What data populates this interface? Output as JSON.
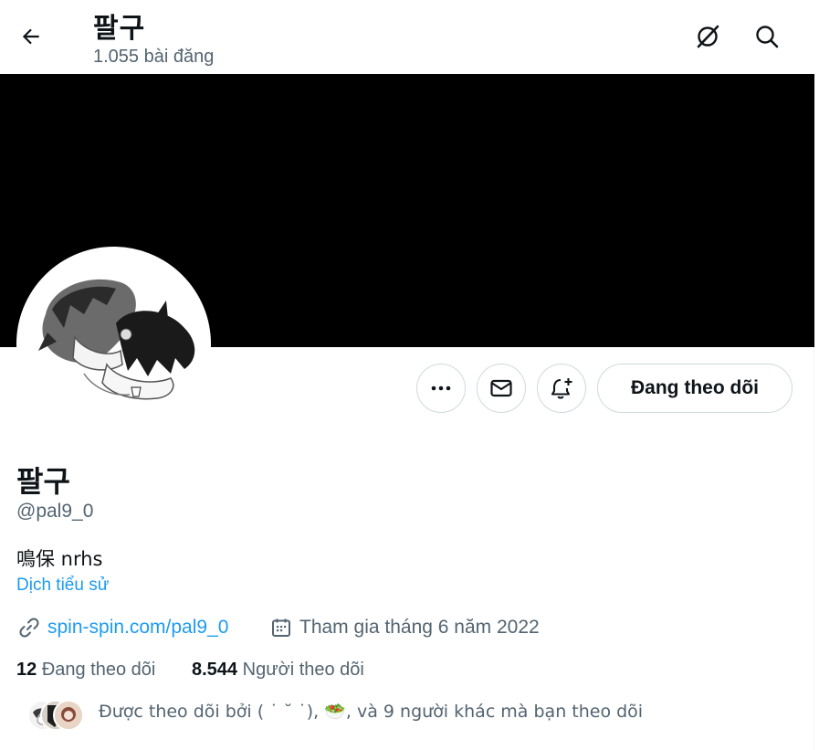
{
  "header": {
    "title": "팔구",
    "post_count": "1.055 bài đăng",
    "icons": [
      "back-arrow-icon",
      "grok-icon",
      "search-icon"
    ]
  },
  "profile": {
    "name": "팔구",
    "handle": "@pal9_0",
    "bio": "鳴保 nrhs",
    "translate_label": "Dịch tiểu sử",
    "website": "spin-spin.com/pal9_0",
    "joined": "Tham gia tháng 6 năm 2022"
  },
  "actions": {
    "more_icon": "more-icon",
    "message_icon": "mail-icon",
    "notify_icon": "bell-plus-icon",
    "follow_label": "Đang theo dõi"
  },
  "stats": {
    "following_count": "12",
    "following_label": "Đang theo dõi",
    "followers_count": "8.544",
    "followers_label": "Người theo dõi"
  },
  "followed_by": {
    "text": "Được theo dõi bởi ( ˙ ˘ ˙), 🥗, và 9 người khác mà bạn theo dõi"
  },
  "colors": {
    "accent": "#1d9bf0",
    "secondary_text": "#536471",
    "banner": "#000000",
    "border": "#cfd9de"
  }
}
